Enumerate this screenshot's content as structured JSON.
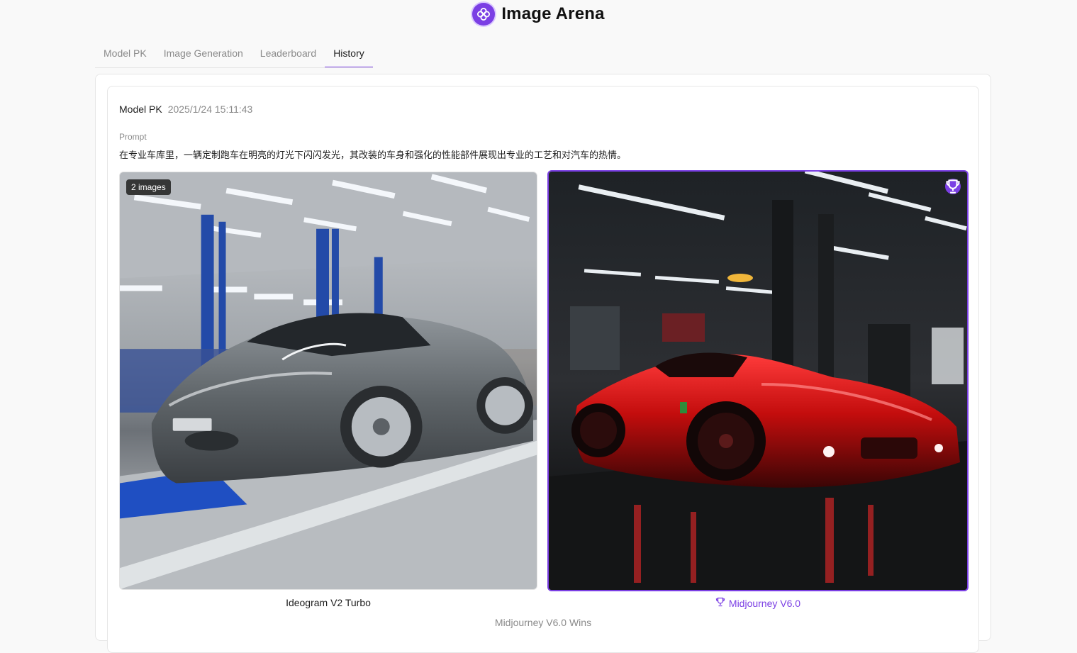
{
  "app": {
    "title": "Image Arena",
    "logo_icon": "flower-logo-icon",
    "accent": "#7b3fe4"
  },
  "tabs": [
    {
      "label": "Model PK",
      "active": false
    },
    {
      "label": "Image Generation",
      "active": false
    },
    {
      "label": "Leaderboard",
      "active": false
    },
    {
      "label": "History",
      "active": true
    }
  ],
  "record": {
    "mode": "Model PK",
    "timestamp": "2025/1/24 15:11:43",
    "prompt_label": "Prompt",
    "prompt": "在专业车库里，一辆定制跑车在明亮的灯光下闪闪发光，其改装的车身和强化的性能部件展现出专业的工艺和对汽车的热情。",
    "left": {
      "model": "Ideogram V2 Turbo",
      "badge": "2 images",
      "image": "grey-sports-car-garage"
    },
    "right": {
      "model": "Midjourney V6.0",
      "winner": true,
      "winner_icon": "trophy-icon",
      "image": "red-sports-car-garage"
    },
    "result": "Midjourney V6.0 Wins"
  }
}
